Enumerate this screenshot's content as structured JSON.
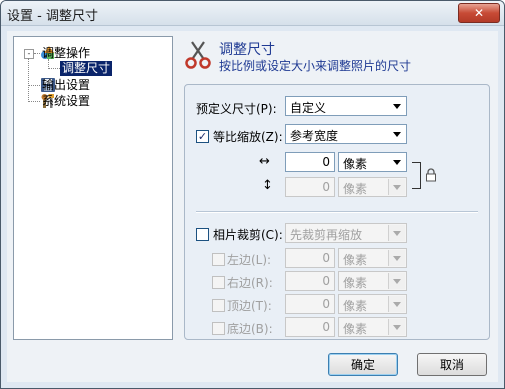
{
  "window": {
    "title": "设置 - 调整尺寸",
    "close_label": "✕"
  },
  "tree": {
    "items": [
      {
        "label": "调整操作",
        "icon": "shapes-icon"
      },
      {
        "label": "调整尺寸",
        "icon": "scissors-icon",
        "selected": true
      },
      {
        "label": "输出设置",
        "icon": "floppy-disk-icon"
      },
      {
        "label": "系统设置",
        "icon": "tools-icon"
      }
    ],
    "expander": "-"
  },
  "header": {
    "title": "调整尺寸",
    "subtitle": "按比例或设定大小来调整照片的尺寸"
  },
  "size": {
    "preset_label": "预定义尺寸(P):",
    "preset_value": "自定义",
    "proportional_label": "等比缩放(Z):",
    "proportional_checked": true,
    "proportional_value": "参考宽度",
    "width_arrow": "↔",
    "width_value": "0",
    "width_unit": "像素",
    "height_arrow": "↕",
    "height_value": "0",
    "height_unit": "像素"
  },
  "crop": {
    "label": "相片裁剪(C):",
    "checked": false,
    "mode_value": "先裁剪再缩放",
    "edges": [
      {
        "label": "左边(L):",
        "value": "0",
        "unit": "像素"
      },
      {
        "label": "右边(R):",
        "value": "0",
        "unit": "像素"
      },
      {
        "label": "顶边(T):",
        "value": "0",
        "unit": "像素"
      },
      {
        "label": "底边(B):",
        "value": "0",
        "unit": "像素"
      }
    ]
  },
  "buttons": {
    "ok": "确定",
    "cancel": "取消"
  },
  "colors": {
    "accent_text": "#1f3a93",
    "selection": "#0a246a",
    "close": "#c74b36"
  }
}
